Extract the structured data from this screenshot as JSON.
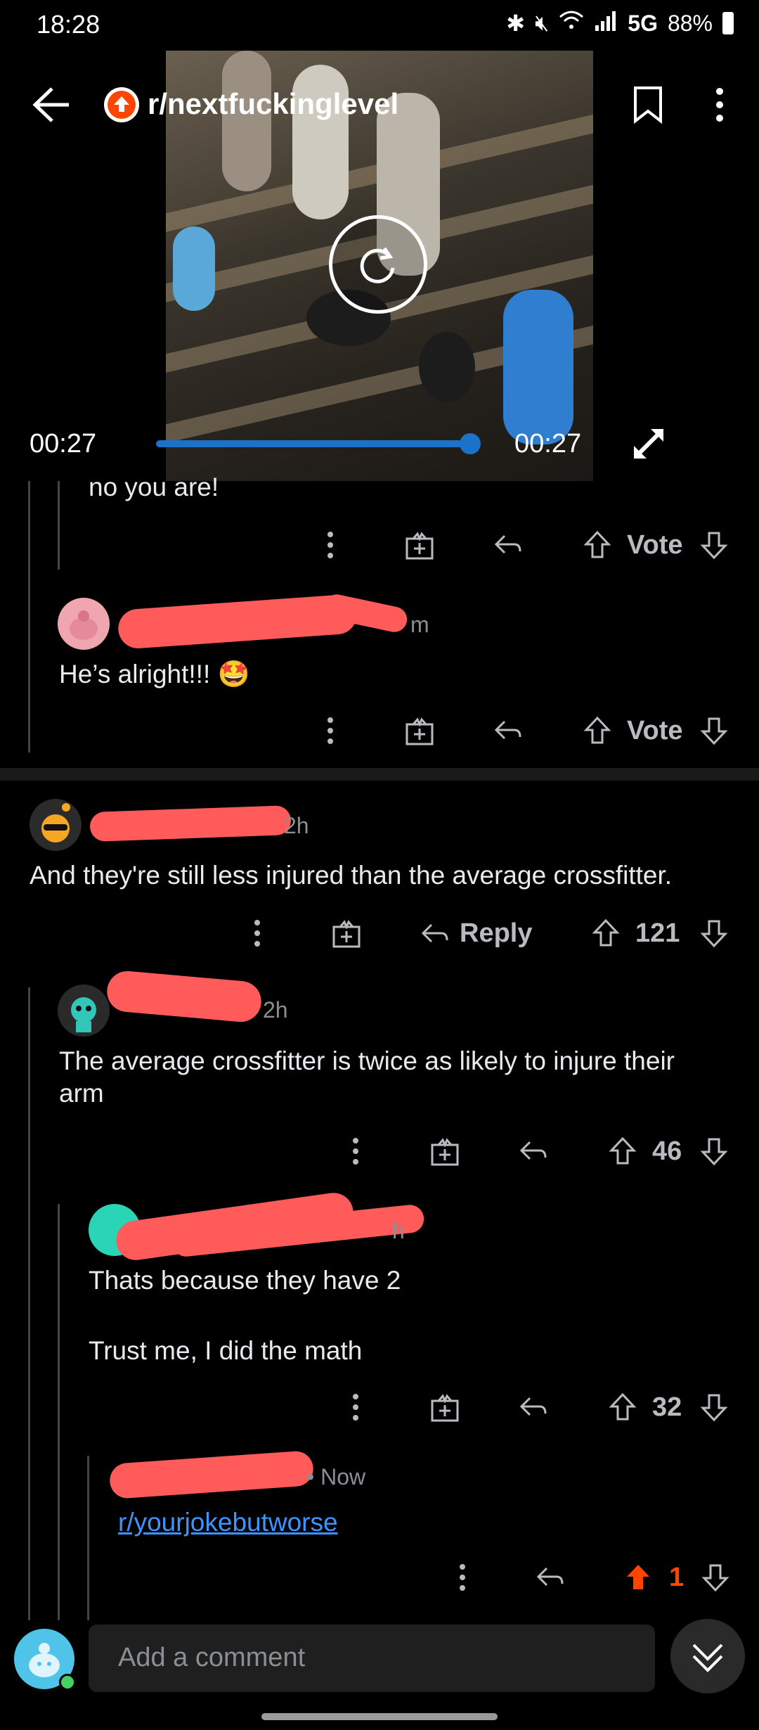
{
  "status": {
    "time": "18:28",
    "network": "5G",
    "battery": "88%"
  },
  "header": {
    "subreddit": "r/nextfuckinglevel"
  },
  "video": {
    "elapsed": "00:27",
    "duration": "00:27",
    "progress": 1.0
  },
  "comments": [
    {
      "text": "no you are!",
      "vote_label": "Vote"
    },
    {
      "age_suffix": "m",
      "text": "He’s alright!!! 🤩",
      "vote_label": "Vote"
    },
    {
      "age": "2h",
      "text": "And they're still less injured than the average crossfitter.",
      "reply_label": "Reply",
      "score": "121"
    },
    {
      "age": "2h",
      "text_line1": "The average crossfitter is twice as likely to injure their",
      "text_line2": "arm",
      "score": "46"
    },
    {
      "age_suffix": "h",
      "text_line1": "Thats because they have 2",
      "text_line2": "Trust me, I did the math",
      "score": "32"
    },
    {
      "age": "• Now",
      "link": "r/yourjokebutworse",
      "score": "1"
    }
  ],
  "composer": {
    "placeholder": "Add a comment"
  },
  "colors": {
    "upvote_active": "#ff4500",
    "link": "#3d94ff",
    "redaction": "#ff5b5b"
  }
}
